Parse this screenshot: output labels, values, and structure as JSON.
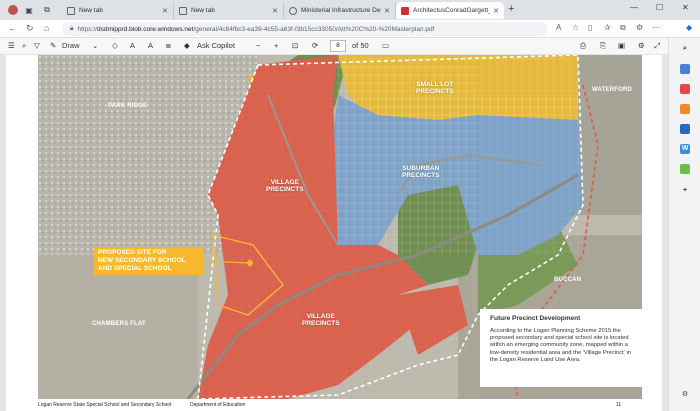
{
  "tabs": [
    {
      "label": "New tab",
      "active": false
    },
    {
      "label": "New tab",
      "active": false
    },
    {
      "label": "Ministerial Infrastructure Design",
      "active": false
    },
    {
      "label": "ArchitectusConradGargett_Desig",
      "active": true
    }
  ],
  "address": {
    "url_prefix": "https://",
    "url_domain": "dsdmipprd.blob.core.windows.net",
    "url_path": "/general/4c84fbc3-ea39-4c55-a63f-f3b15cc33050/Att%20C%20-%20Masterplan.pdf"
  },
  "pdf_toolbar": {
    "draw_label": "Draw",
    "ask_copilot_label": "Ask Copilot",
    "page_number": "8",
    "page_total": "of 50"
  },
  "map": {
    "labels": {
      "park_ridge": "PARK RIDGE",
      "small_lot": "SMALL LOT\nPRECINCTS",
      "waterford": "WATERFORD",
      "village_upper": "VILLAGE\nPRECINCTS",
      "suburban": "SUBURBAN\nPRECINCTS",
      "buccan": "BUCCAN",
      "chambers_flat": "CHAMBERS FLAT",
      "village_lower": "VILLAGE\nPRECINCTS"
    },
    "proposed_site": "PROPOSED SITE FOR\nNEW SECONDARY SCHOOL\nAND SPECIAL SCHOOL",
    "info_title": "Future Precinct Development",
    "info_body": "According to the Logan Planning Scheme 2015 the proposed secondary and special school site is located within an emerging community zone, mapped within a low-density residential area and the 'Village Precinct' in the Logan Reserve Land Use Area."
  },
  "footer": {
    "left": "Logan Reserve State Special School and Secondary School",
    "center": "Department of Education",
    "right": "11"
  },
  "colors": {
    "village_red": "#d9614d",
    "suburban_blue": "#7fa3c6",
    "small_lot_yellow": "#e5b93a",
    "proposed_orange": "#f5b82e",
    "green_corridor": "#6f8f52"
  }
}
